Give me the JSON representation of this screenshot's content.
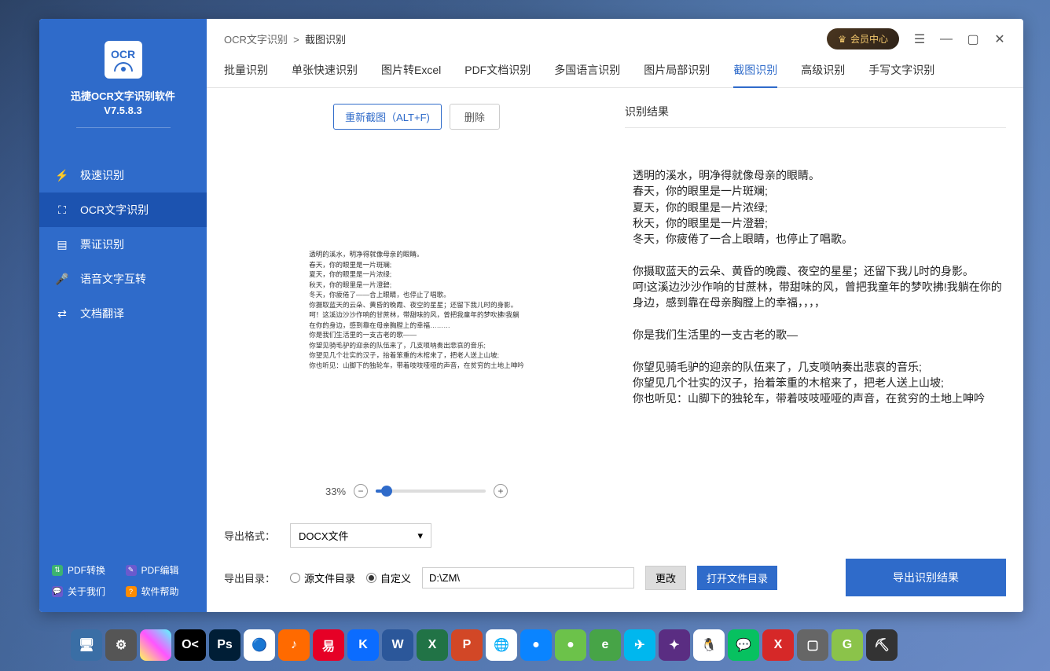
{
  "app": {
    "name": "迅捷OCR文字识别软件",
    "version": "V7.5.8.3"
  },
  "sidebar": {
    "items": [
      {
        "label": "极速识别"
      },
      {
        "label": "OCR文字识别"
      },
      {
        "label": "票证识别"
      },
      {
        "label": "语音文字互转"
      },
      {
        "label": "文档翻译"
      }
    ],
    "footer": {
      "pdf_convert": "PDF转换",
      "pdf_edit": "PDF编辑",
      "about": "关于我们",
      "help": "软件帮助"
    }
  },
  "titlebar": {
    "breadcrumb_root": "OCR文字识别",
    "breadcrumb_sep": ">",
    "breadcrumb_current": "截图识别",
    "vip_label": "会员中心"
  },
  "tabs": [
    "批量识别",
    "单张快速识别",
    "图片转Excel",
    "PDF文档识别",
    "多国语言识别",
    "图片局部识别",
    "截图识别",
    "高级识别",
    "手写文字识别"
  ],
  "active_tab_index": 6,
  "left_pane": {
    "recapture_btn": "重新截图（ALT+F)",
    "delete_btn": "删除",
    "preview_lines": [
      "透明的溪水，明净得就像母亲的眼睛。",
      "春天，你的眼里是一片斑斓;",
      "夏天，你的眼里是一片浓绿;",
      "秋天，你的眼里是一片澄碧;",
      "冬天，你疲倦了——合上眼睛，也停止了唱歌。",
      "你摄取蓝天的云朵、黄昏的晚霞、夜空的星星；还留下我儿时的身影。",
      "呵！这溪边沙沙作响的甘蔗林，带甜味的风，曾把我童年的梦吹拂!我躺",
      "在你的身边，感到靠在母亲胸膛上的幸福………",
      "你是我们生活里的一支古老的歌——",
      "你望见骑毛驴的迎亲的队伍来了，几支唢呐奏出悲哀的音乐;",
      "你望见几个壮实的汉子，抬着笨重的木棺来了，把老人送上山坡;",
      "你也听见：山脚下的独轮车，带着吱吱哑哑的声音，在贫穷的土地上呻吟"
    ],
    "zoom": {
      "percent": "33%"
    }
  },
  "right_pane": {
    "header": "识别结果",
    "result_lines": [
      "透明的溪水，明净得就像母亲的眼睛。",
      "春天，你的眼里是一片斑斓;",
      "夏天，你的眼里是一片浓绿;",
      "秋天，你的眼里是一片澄碧;",
      "冬天，你疲倦了一合上眼睛，也停止了唱歌。",
      "",
      "你摄取蓝天的云朵、黄昏的晚霞、夜空的星星；还留下我儿时的身影。",
      "呵!这溪边沙沙作响的甘蔗林，带甜味的风，曾把我童年的梦吹拂!我躺在你的身边，感到靠在母亲胸膛上的幸福，，，，",
      "",
      "你是我们生活里的一支古老的歌—",
      "",
      "你望见骑毛驴的迎亲的队伍来了，几支唢呐奏出悲哀的音乐;",
      "你望见几个壮实的汉子，抬着笨重的木棺来了，把老人送上山坡;",
      "你也听见：山脚下的独轮车，带着吱吱哑哑的声音，在贫穷的土地上呻吟"
    ]
  },
  "bottom": {
    "format_label": "导出格式：",
    "format_value": "DOCX文件",
    "dir_label": "导出目录：",
    "radio_source": "源文件目录",
    "radio_custom": "自定义",
    "path": "D:\\ZM\\",
    "change_btn": "更改",
    "open_dir_btn": "打开文件目录",
    "export_btn": "导出识别结果"
  },
  "taskbar": [
    {
      "bg": "#3a6ea5",
      "t": "🖥"
    },
    {
      "bg": "#555",
      "t": "⚙"
    },
    {
      "bg": "linear-gradient(45deg,#ff5,#f5f,#5ff)",
      "t": ""
    },
    {
      "bg": "#000",
      "t": "O<"
    },
    {
      "bg": "#001e36",
      "t": "Ps"
    },
    {
      "bg": "#fff",
      "t": "🔵"
    },
    {
      "bg": "#ff6a00",
      "t": "♪"
    },
    {
      "bg": "#e60026",
      "t": "易"
    },
    {
      "bg": "#0b6cff",
      "t": "K"
    },
    {
      "bg": "#2b579a",
      "t": "W"
    },
    {
      "bg": "#217346",
      "t": "X"
    },
    {
      "bg": "#d24726",
      "t": "P"
    },
    {
      "bg": "#fff",
      "t": "🌐"
    },
    {
      "bg": "#0a84ff",
      "t": "●"
    },
    {
      "bg": "#6cc24a",
      "t": "●"
    },
    {
      "bg": "#47a447",
      "t": "e"
    },
    {
      "bg": "#00b7ee",
      "t": "✈"
    },
    {
      "bg": "#5a2d82",
      "t": "✦"
    },
    {
      "bg": "#fff",
      "t": "🐧"
    },
    {
      "bg": "#07c160",
      "t": "💬"
    },
    {
      "bg": "#d62828",
      "t": "X"
    },
    {
      "bg": "#666",
      "t": "▢"
    },
    {
      "bg": "#8bc34a",
      "t": "G"
    },
    {
      "bg": "#333",
      "t": "⛏"
    }
  ]
}
